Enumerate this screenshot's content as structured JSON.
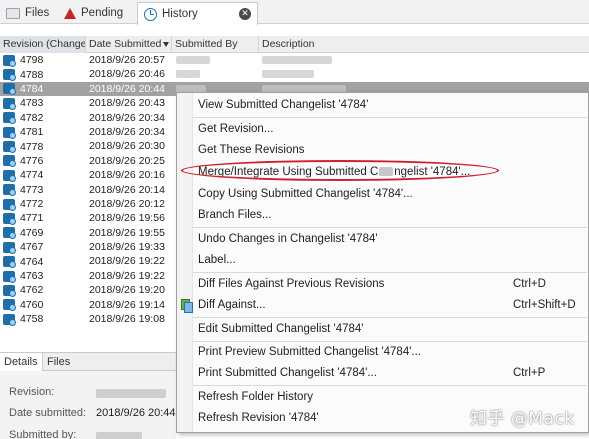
{
  "tabs": [
    {
      "label": "Files",
      "icon": "folder-icon"
    },
    {
      "label": "Pending",
      "icon": "pending-warning-icon"
    },
    {
      "label": "History",
      "icon": "clock-history-icon",
      "active": true
    }
  ],
  "columns": {
    "revision": "Revision (Changel",
    "date_submitted": "Date Submitted",
    "submitted_by": "Submitted By",
    "description": "Description"
  },
  "rows": [
    {
      "revision": "4798",
      "date": "2018/9/26 20:57"
    },
    {
      "revision": "4788",
      "date": "2018/9/26 20:46"
    },
    {
      "revision": "4784",
      "date": "2018/9/26 20:44",
      "selected": true
    },
    {
      "revision": "4783",
      "date": "2018/9/26 20:43"
    },
    {
      "revision": "4782",
      "date": "2018/9/26 20:34"
    },
    {
      "revision": "4781",
      "date": "2018/9/26 20:34"
    },
    {
      "revision": "4778",
      "date": "2018/9/26 20:30"
    },
    {
      "revision": "4776",
      "date": "2018/9/26 20:25"
    },
    {
      "revision": "4774",
      "date": "2018/9/26 20:16"
    },
    {
      "revision": "4773",
      "date": "2018/9/26 20:14"
    },
    {
      "revision": "4772",
      "date": "2018/9/26 20:12"
    },
    {
      "revision": "4771",
      "date": "2018/9/26 19:56"
    },
    {
      "revision": "4769",
      "date": "2018/9/26 19:55"
    },
    {
      "revision": "4767",
      "date": "2018/9/26 19:33"
    },
    {
      "revision": "4764",
      "date": "2018/9/26 19:22"
    },
    {
      "revision": "4763",
      "date": "2018/9/26 19:22"
    },
    {
      "revision": "4762",
      "date": "2018/9/26 19:20"
    },
    {
      "revision": "4760",
      "date": "2018/9/26 19:14"
    },
    {
      "revision": "4758",
      "date": "2018/9/26 19:08"
    }
  ],
  "details": {
    "tabs": [
      "Details",
      "Files"
    ],
    "revision_label": "Revision:",
    "date_label": "Date submitted:",
    "date_value": "2018/9/26 20:44",
    "submitted_by_label": "Submitted by:"
  },
  "context_menu": {
    "view": "View Submitted Changelist '4784'",
    "get_revision": "Get Revision...",
    "get_these": "Get These Revisions",
    "merge": "Merge/Integrate Using Submitted C",
    "merge_tail": "ngelist '4784'...",
    "copy": "Copy Using Submitted Changelist '4784'...",
    "branch": "Branch Files...",
    "undo": "Undo Changes in Changelist '4784'",
    "label": "Label...",
    "diff_prev": "Diff Files Against Previous Revisions",
    "diff_prev_shortcut": "Ctrl+D",
    "diff_against": "Diff Against...",
    "diff_against_shortcut": "Ctrl+Shift+D",
    "edit": "Edit Submitted Changelist '4784'",
    "print_preview": "Print Preview Submitted Changelist '4784'...",
    "print": "Print Submitted Changelist '4784'...",
    "print_shortcut": "Ctrl+P",
    "refresh_folder": "Refresh Folder History",
    "refresh_revision": "Refresh Revision '4784'"
  },
  "watermark": "知乎 @Mack",
  "colors": {
    "accent_blue": "#1a6fb5",
    "pending_red": "#c0262c",
    "selection_gray": "#a2a2a2",
    "annotation_red": "#cf1f2e"
  }
}
